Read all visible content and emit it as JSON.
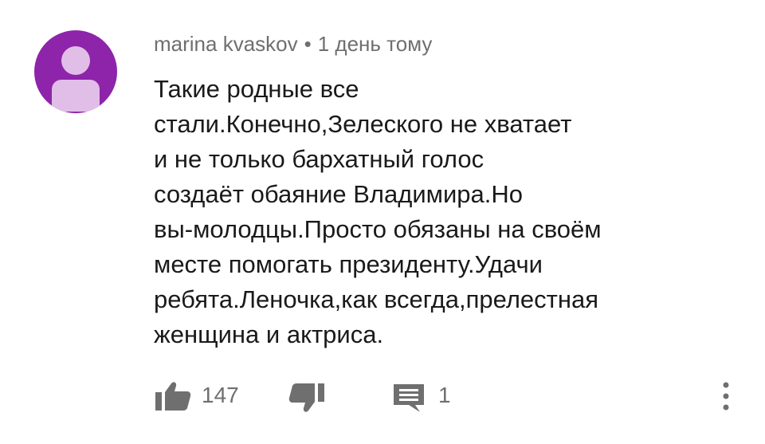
{
  "comment": {
    "author": "marina kvaskov",
    "separator": "•",
    "timestamp": "1 день тому",
    "avatar_color": "#8e24aa",
    "avatar_figure_color": "#e1bee7",
    "text_lines": [
      "Такие родные все",
      "стали.Конечно,Зелеского не хватает",
      "и не только бархатный голос",
      "создаёт обаяние Владимира.Но",
      "вы-молодцы.Просто обязаны на своём",
      "месте помогать президенту.Удачи",
      "ребята.Леночка,как всегда,прелестная",
      "женщина и актриса."
    ]
  },
  "actions": {
    "like_icon": "thumbs-up-icon",
    "like_count": "147",
    "dislike_icon": "thumbs-down-icon",
    "reply_icon": "reply-icon",
    "reply_count": "1",
    "more_icon": "more-vert-icon",
    "icon_color": "#6f6f6f"
  }
}
